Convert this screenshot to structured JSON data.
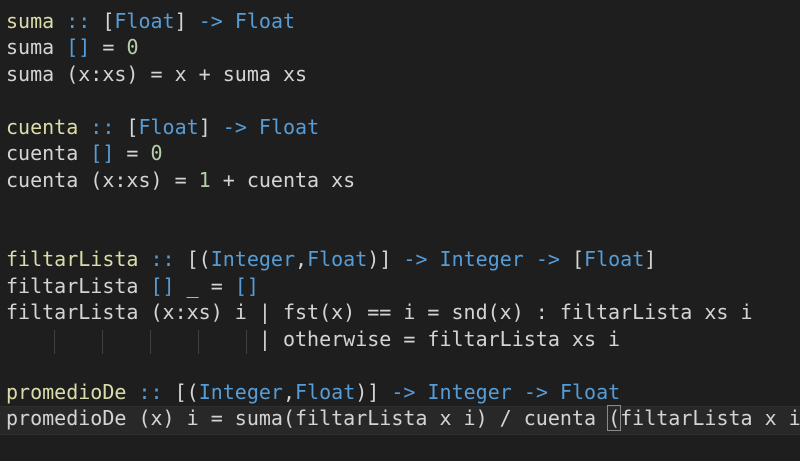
{
  "editor": {
    "language": "Haskell",
    "colors": {
      "background": "#1e1e1e",
      "function": "#dcdcaa",
      "type": "#569cd6",
      "number": "#b5cea8",
      "text": "#d4d4d4",
      "current_line": "#282828"
    },
    "lines": [
      {
        "id": "line-1",
        "segments": [
          {
            "text": "suma",
            "cls": "fn"
          },
          {
            "text": " :: ",
            "cls": "type"
          },
          {
            "text": "[",
            "cls": "plain"
          },
          {
            "text": "Float",
            "cls": "type"
          },
          {
            "text": "] ",
            "cls": "plain"
          },
          {
            "text": "-> Float",
            "cls": "type"
          }
        ]
      },
      {
        "id": "line-2",
        "segments": [
          {
            "text": "suma ",
            "cls": "plain"
          },
          {
            "text": "[]",
            "cls": "type"
          },
          {
            "text": " = ",
            "cls": "plain"
          },
          {
            "text": "0",
            "cls": "num"
          }
        ]
      },
      {
        "id": "line-3",
        "segments": [
          {
            "text": "suma (x:xs) = x + suma xs",
            "cls": "plain"
          }
        ]
      },
      {
        "id": "line-4",
        "segments": []
      },
      {
        "id": "line-5",
        "segments": [
          {
            "text": "cuenta",
            "cls": "fn"
          },
          {
            "text": " :: ",
            "cls": "type"
          },
          {
            "text": "[",
            "cls": "plain"
          },
          {
            "text": "Float",
            "cls": "type"
          },
          {
            "text": "] ",
            "cls": "plain"
          },
          {
            "text": "-> Float",
            "cls": "type"
          }
        ]
      },
      {
        "id": "line-6",
        "segments": [
          {
            "text": "cuenta ",
            "cls": "plain"
          },
          {
            "text": "[]",
            "cls": "type"
          },
          {
            "text": " = ",
            "cls": "plain"
          },
          {
            "text": "0",
            "cls": "num"
          }
        ]
      },
      {
        "id": "line-7",
        "segments": [
          {
            "text": "cuenta (x:xs) = ",
            "cls": "plain"
          },
          {
            "text": "1",
            "cls": "num"
          },
          {
            "text": " + cuenta xs",
            "cls": "plain"
          }
        ]
      },
      {
        "id": "line-8",
        "segments": []
      },
      {
        "id": "line-9",
        "segments": []
      },
      {
        "id": "line-10",
        "segments": [
          {
            "text": "filtarLista",
            "cls": "fn"
          },
          {
            "text": " :: ",
            "cls": "type"
          },
          {
            "text": "[(",
            "cls": "plain"
          },
          {
            "text": "Integer",
            "cls": "type"
          },
          {
            "text": ",",
            "cls": "plain"
          },
          {
            "text": "Float",
            "cls": "type"
          },
          {
            "text": ")] ",
            "cls": "plain"
          },
          {
            "text": "-> Integer ->",
            "cls": "type"
          },
          {
            "text": " [",
            "cls": "plain"
          },
          {
            "text": "Float",
            "cls": "type"
          },
          {
            "text": "]",
            "cls": "plain"
          }
        ]
      },
      {
        "id": "line-11",
        "segments": [
          {
            "text": "filtarLista ",
            "cls": "plain"
          },
          {
            "text": "[]",
            "cls": "type"
          },
          {
            "text": " _ = ",
            "cls": "plain"
          },
          {
            "text": "[]",
            "cls": "type"
          }
        ]
      },
      {
        "id": "line-12",
        "segments": [
          {
            "text": "filtarLista (x:xs) i | fst(x) == i = snd(x) : filtarLista xs i",
            "cls": "plain"
          }
        ]
      },
      {
        "id": "line-13",
        "segments": [
          {
            "text": "                     | otherwise = filtarLista xs i",
            "cls": "plain"
          }
        ]
      },
      {
        "id": "line-14",
        "segments": []
      },
      {
        "id": "line-15",
        "segments": [
          {
            "text": "promedioDe",
            "cls": "fn"
          },
          {
            "text": " :: ",
            "cls": "type"
          },
          {
            "text": "[(",
            "cls": "plain"
          },
          {
            "text": "Integer",
            "cls": "type"
          },
          {
            "text": ",",
            "cls": "plain"
          },
          {
            "text": "Float",
            "cls": "type"
          },
          {
            "text": ")] ",
            "cls": "plain"
          },
          {
            "text": "-> Integer -> Float",
            "cls": "type"
          }
        ]
      },
      {
        "id": "line-16",
        "segments": [
          {
            "text": "promedioDe (x) i = suma(filtarLista x i) / cuenta ",
            "cls": "plain"
          },
          {
            "text": "(",
            "cls": "bracket-box"
          },
          {
            "text": "filtarLista x i",
            "cls": "plain"
          },
          {
            "text": ")",
            "cls": "bracket-box"
          }
        ]
      }
    ]
  }
}
